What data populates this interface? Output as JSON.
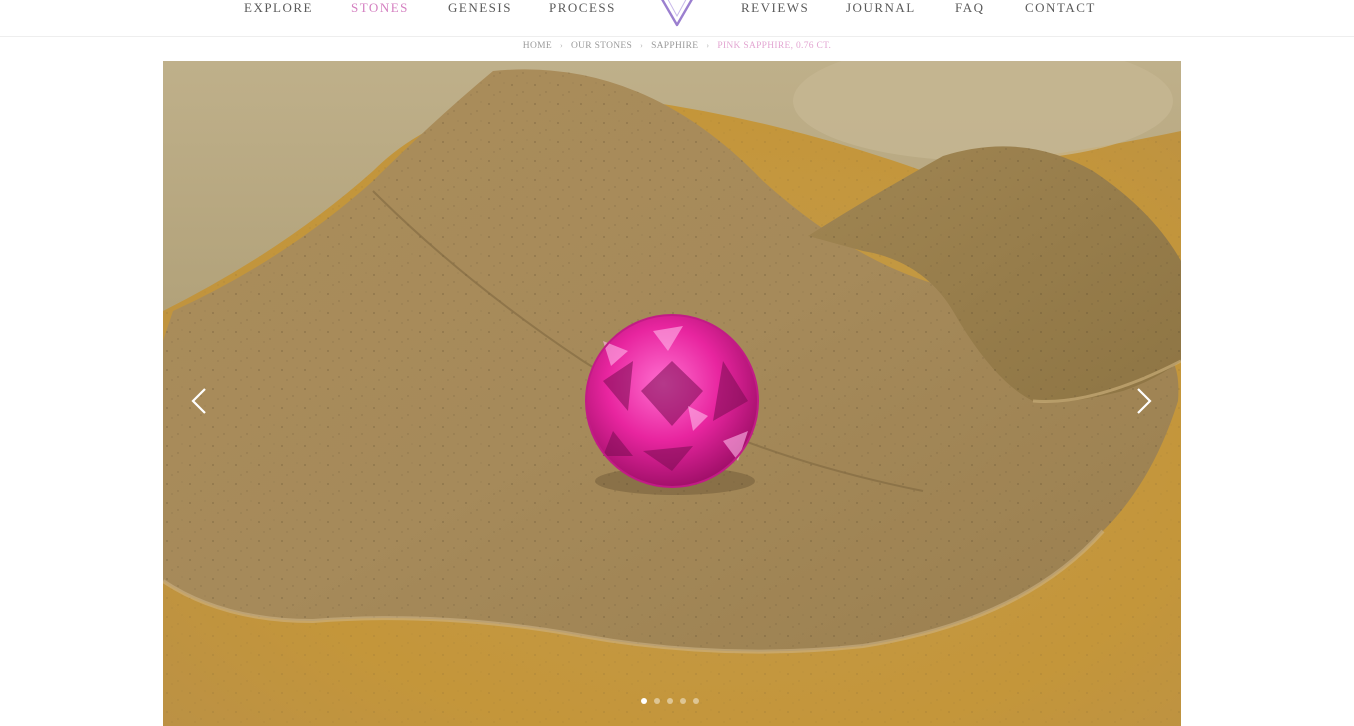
{
  "nav": {
    "items": [
      {
        "label": "EXPLORE",
        "active": false
      },
      {
        "label": "STONES",
        "active": true
      },
      {
        "label": "GENESIS",
        "active": false
      },
      {
        "label": "PROCESS",
        "active": false
      },
      {
        "label": "REVIEWS",
        "active": false
      },
      {
        "label": "JOURNAL",
        "active": false
      },
      {
        "label": "FAQ",
        "active": false
      },
      {
        "label": "CONTACT",
        "active": false
      }
    ],
    "logo_icon": "v-diamond-logo-icon",
    "active_color": "#d47fc0"
  },
  "breadcrumb": {
    "items": [
      "HOME",
      "OUR STONES",
      "SAPPHIRE"
    ],
    "current": "PINK SAPPHIRE, 0.76 CT.",
    "separator_icon": "chevron-right-icon",
    "current_color": "#e3a6d2"
  },
  "gallery": {
    "image_subject": "pink sapphire on dried leaf",
    "prev_icon": "chevron-left-icon",
    "next_icon": "chevron-right-icon",
    "slide_count": 5,
    "active_slide": 1,
    "gem_color": "#e8259f"
  }
}
